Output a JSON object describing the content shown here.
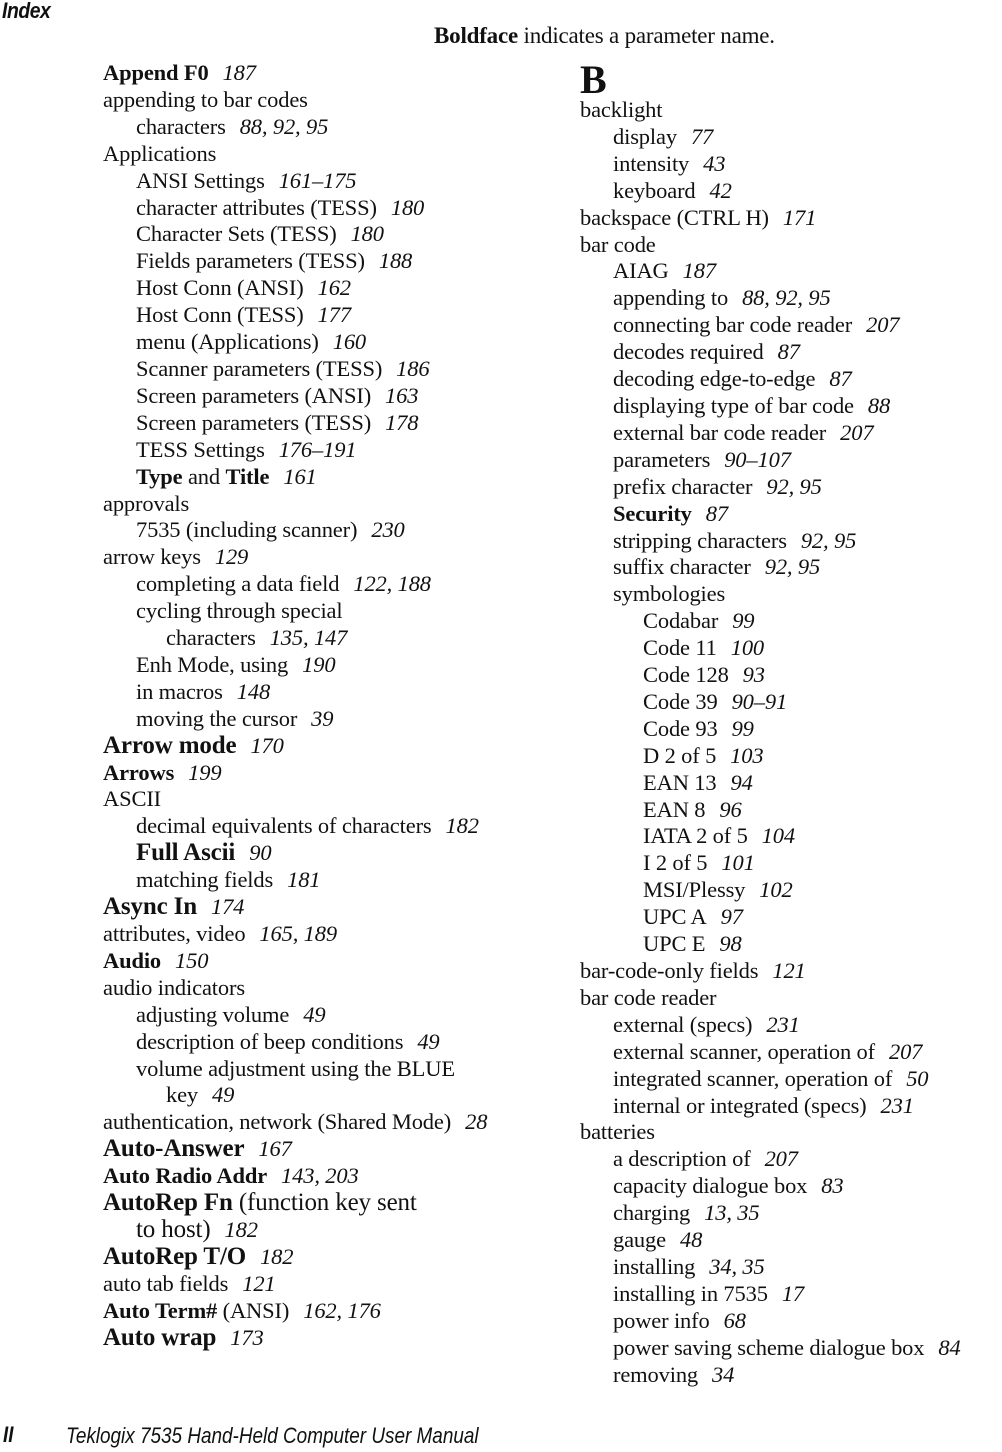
{
  "header": {
    "title": "Index"
  },
  "legend": {
    "bold_word": "Boldface",
    "rest": " indicates a parameter name."
  },
  "columns": [
    {
      "entries": [
        {
          "level": 1,
          "parts": [
            {
              "t": "Append F0",
              "b": true
            }
          ],
          "pages": "187"
        },
        {
          "level": 1,
          "parts": [
            {
              "t": "appending to bar codes"
            }
          ],
          "pages": ""
        },
        {
          "level": 2,
          "parts": [
            {
              "t": "characters"
            }
          ],
          "pages": "88, 92, 95"
        },
        {
          "level": 1,
          "parts": [
            {
              "t": "Applications"
            }
          ],
          "pages": ""
        },
        {
          "level": 2,
          "parts": [
            {
              "t": "ANSI Settings"
            }
          ],
          "pages": "161–175"
        },
        {
          "level": 2,
          "parts": [
            {
              "t": "character attributes (TESS)"
            }
          ],
          "pages": "180"
        },
        {
          "level": 2,
          "parts": [
            {
              "t": "Character Sets (TESS)"
            }
          ],
          "pages": "180"
        },
        {
          "level": 2,
          "parts": [
            {
              "t": "Fields parameters (TESS)"
            }
          ],
          "pages": "188"
        },
        {
          "level": 2,
          "parts": [
            {
              "t": "Host Conn (ANSI)"
            }
          ],
          "pages": "162"
        },
        {
          "level": 2,
          "parts": [
            {
              "t": "Host Conn (TESS)"
            }
          ],
          "pages": "177"
        },
        {
          "level": 2,
          "parts": [
            {
              "t": "menu (Applications)"
            }
          ],
          "pages": "160"
        },
        {
          "level": 2,
          "parts": [
            {
              "t": "Scanner parameters (TESS)"
            }
          ],
          "pages": "186"
        },
        {
          "level": 2,
          "parts": [
            {
              "t": "Screen parameters (ANSI)"
            }
          ],
          "pages": "163"
        },
        {
          "level": 2,
          "parts": [
            {
              "t": "Screen parameters (TESS)"
            }
          ],
          "pages": "178"
        },
        {
          "level": 2,
          "parts": [
            {
              "t": "TESS Settings"
            }
          ],
          "pages": "176–191"
        },
        {
          "level": 2,
          "parts": [
            {
              "t": "Type",
              "b": true
            },
            {
              "t": " and "
            },
            {
              "t": "Title",
              "b": true
            }
          ],
          "pages": "161"
        },
        {
          "level": 1,
          "parts": [
            {
              "t": "approvals"
            }
          ],
          "pages": ""
        },
        {
          "level": 2,
          "parts": [
            {
              "t": "7535 (including scanner)"
            }
          ],
          "pages": "230"
        },
        {
          "level": 1,
          "parts": [
            {
              "t": "arrow keys"
            }
          ],
          "pages": "129"
        },
        {
          "level": 2,
          "parts": [
            {
              "t": "completing a data field"
            }
          ],
          "pages": "122, 188"
        },
        {
          "level": 2,
          "parts": [
            {
              "t": "cycling through special"
            }
          ],
          "pages": ""
        },
        {
          "level": 3,
          "parts": [
            {
              "t": "characters"
            }
          ],
          "pages": "135, 147"
        },
        {
          "level": 2,
          "parts": [
            {
              "t": "Enh Mode, using"
            }
          ],
          "pages": "190"
        },
        {
          "level": 2,
          "parts": [
            {
              "t": "in macros"
            }
          ],
          "pages": "148"
        },
        {
          "level": 2,
          "parts": [
            {
              "t": "moving the cursor"
            }
          ],
          "pages": "39"
        },
        {
          "level": 1,
          "parts": [
            {
              "t": "Arrow mode",
              "b": true,
              "big": true
            }
          ],
          "pages": "170"
        },
        {
          "level": 1,
          "parts": [
            {
              "t": "Arrows",
              "b": true
            }
          ],
          "pages": "199"
        },
        {
          "level": 1,
          "parts": [
            {
              "t": "ASCII"
            }
          ],
          "pages": ""
        },
        {
          "level": 2,
          "parts": [
            {
              "t": "decimal equivalents of characters"
            }
          ],
          "pages": "182"
        },
        {
          "level": 2,
          "parts": [
            {
              "t": "Full Ascii",
              "b": true,
              "big": true
            }
          ],
          "pages": "90"
        },
        {
          "level": 2,
          "parts": [
            {
              "t": "matching fields"
            }
          ],
          "pages": "181"
        },
        {
          "level": 1,
          "parts": [
            {
              "t": "Async In",
              "b": true,
              "big": true
            }
          ],
          "pages": "174"
        },
        {
          "level": 1,
          "parts": [
            {
              "t": "attributes, video"
            }
          ],
          "pages": "165, 189"
        },
        {
          "level": 1,
          "parts": [
            {
              "t": "Audio",
              "b": true
            }
          ],
          "pages": "150"
        },
        {
          "level": 1,
          "parts": [
            {
              "t": "audio indicators"
            }
          ],
          "pages": ""
        },
        {
          "level": 2,
          "parts": [
            {
              "t": "adjusting volume"
            }
          ],
          "pages": "49"
        },
        {
          "level": 2,
          "parts": [
            {
              "t": "description of beep conditions"
            }
          ],
          "pages": "49"
        },
        {
          "level": 2,
          "parts": [
            {
              "t": "volume adjustment using the BLUE"
            }
          ],
          "pages": ""
        },
        {
          "level": 3,
          "parts": [
            {
              "t": "key"
            }
          ],
          "pages": "49"
        },
        {
          "level": 1,
          "parts": [
            {
              "t": "authentication, network (Shared Mode)"
            }
          ],
          "pages": "28"
        },
        {
          "level": 1,
          "parts": [
            {
              "t": "Auto-Answer",
              "b": true,
              "big": true
            }
          ],
          "pages": "167"
        },
        {
          "level": 1,
          "parts": [
            {
              "t": "Auto Radio Addr",
              "b": true
            }
          ],
          "pages": "143, 203"
        },
        {
          "level": 1,
          "parts": [
            {
              "t": "AutoRep Fn",
              "b": true,
              "big": true
            },
            {
              "t": " (function key sent",
              "big": true
            }
          ],
          "pages": ""
        },
        {
          "level": 2,
          "parts": [
            {
              "t": "to host)",
              "big": true
            }
          ],
          "pages": "182"
        },
        {
          "level": 1,
          "parts": [
            {
              "t": "AutoRep T/O",
              "b": true,
              "big": true
            }
          ],
          "pages": "182"
        },
        {
          "level": 1,
          "parts": [
            {
              "t": "auto tab fields"
            }
          ],
          "pages": "121"
        },
        {
          "level": 1,
          "parts": [
            {
              "t": "Auto Term#",
              "b": true
            },
            {
              "t": " (ANSI)"
            }
          ],
          "pages": "162, 176"
        },
        {
          "level": 1,
          "parts": [
            {
              "t": "Auto wrap",
              "b": true,
              "big": true
            }
          ],
          "pages": "173"
        }
      ]
    },
    {
      "letter": "B",
      "entries": [
        {
          "level": 1,
          "parts": [
            {
              "t": "backlight"
            }
          ],
          "pages": ""
        },
        {
          "level": 2,
          "parts": [
            {
              "t": "display"
            }
          ],
          "pages": "77"
        },
        {
          "level": 2,
          "parts": [
            {
              "t": "intensity"
            }
          ],
          "pages": "43"
        },
        {
          "level": 2,
          "parts": [
            {
              "t": "keyboard"
            }
          ],
          "pages": "42"
        },
        {
          "level": 1,
          "parts": [
            {
              "t": "backspace (CTRL H)"
            }
          ],
          "pages": "171"
        },
        {
          "level": 1,
          "parts": [
            {
              "t": "bar code"
            }
          ],
          "pages": ""
        },
        {
          "level": 2,
          "parts": [
            {
              "t": "AIAG"
            }
          ],
          "pages": "187"
        },
        {
          "level": 2,
          "parts": [
            {
              "t": "appending to"
            }
          ],
          "pages": "88, 92, 95"
        },
        {
          "level": 2,
          "parts": [
            {
              "t": "connecting bar code reader"
            }
          ],
          "pages": "207"
        },
        {
          "level": 2,
          "parts": [
            {
              "t": "decodes required"
            }
          ],
          "pages": "87"
        },
        {
          "level": 2,
          "parts": [
            {
              "t": "decoding edge-to-edge"
            }
          ],
          "pages": "87"
        },
        {
          "level": 2,
          "parts": [
            {
              "t": "displaying type of bar code"
            }
          ],
          "pages": "88"
        },
        {
          "level": 2,
          "parts": [
            {
              "t": "external bar code reader"
            }
          ],
          "pages": "207"
        },
        {
          "level": 2,
          "parts": [
            {
              "t": "parameters"
            }
          ],
          "pages": "90–107"
        },
        {
          "level": 2,
          "parts": [
            {
              "t": "prefix character"
            }
          ],
          "pages": "92, 95"
        },
        {
          "level": 2,
          "parts": [
            {
              "t": "Security",
              "b": true
            }
          ],
          "pages": "87"
        },
        {
          "level": 2,
          "parts": [
            {
              "t": "stripping characters"
            }
          ],
          "pages": "92, 95"
        },
        {
          "level": 2,
          "parts": [
            {
              "t": "suffix character"
            }
          ],
          "pages": "92, 95"
        },
        {
          "level": 2,
          "parts": [
            {
              "t": "symbologies"
            }
          ],
          "pages": ""
        },
        {
          "level": 3,
          "parts": [
            {
              "t": "Codabar"
            }
          ],
          "pages": "99"
        },
        {
          "level": 3,
          "parts": [
            {
              "t": "Code 11"
            }
          ],
          "pages": "100"
        },
        {
          "level": 3,
          "parts": [
            {
              "t": "Code 128"
            }
          ],
          "pages": "93"
        },
        {
          "level": 3,
          "parts": [
            {
              "t": "Code 39"
            }
          ],
          "pages": "90–91"
        },
        {
          "level": 3,
          "parts": [
            {
              "t": "Code 93"
            }
          ],
          "pages": "99"
        },
        {
          "level": 3,
          "parts": [
            {
              "t": "D 2 of 5"
            }
          ],
          "pages": "103"
        },
        {
          "level": 3,
          "parts": [
            {
              "t": "EAN 13"
            }
          ],
          "pages": "94"
        },
        {
          "level": 3,
          "parts": [
            {
              "t": "EAN 8"
            }
          ],
          "pages": "96"
        },
        {
          "level": 3,
          "parts": [
            {
              "t": "IATA 2 of 5"
            }
          ],
          "pages": "104"
        },
        {
          "level": 3,
          "parts": [
            {
              "t": "I 2 of 5"
            }
          ],
          "pages": "101"
        },
        {
          "level": 3,
          "parts": [
            {
              "t": "MSI/Plessy"
            }
          ],
          "pages": "102"
        },
        {
          "level": 3,
          "parts": [
            {
              "t": "UPC A"
            }
          ],
          "pages": "97"
        },
        {
          "level": 3,
          "parts": [
            {
              "t": "UPC E"
            }
          ],
          "pages": "98"
        },
        {
          "level": 1,
          "parts": [
            {
              "t": "bar-code-only fields"
            }
          ],
          "pages": "121"
        },
        {
          "level": 1,
          "parts": [
            {
              "t": "bar code reader"
            }
          ],
          "pages": ""
        },
        {
          "level": 2,
          "parts": [
            {
              "t": "external (specs)"
            }
          ],
          "pages": "231"
        },
        {
          "level": 2,
          "parts": [
            {
              "t": "external scanner, operation of"
            }
          ],
          "pages": "207"
        },
        {
          "level": 2,
          "parts": [
            {
              "t": "integrated scanner, operation of"
            }
          ],
          "pages": "50"
        },
        {
          "level": 2,
          "parts": [
            {
              "t": "internal or integrated (specs)"
            }
          ],
          "pages": "231"
        },
        {
          "level": 1,
          "parts": [
            {
              "t": "batteries"
            }
          ],
          "pages": ""
        },
        {
          "level": 2,
          "parts": [
            {
              "t": "a description of"
            }
          ],
          "pages": "207"
        },
        {
          "level": 2,
          "parts": [
            {
              "t": "capacity dialogue box"
            }
          ],
          "pages": "83"
        },
        {
          "level": 2,
          "parts": [
            {
              "t": "charging"
            }
          ],
          "pages": "13, 35"
        },
        {
          "level": 2,
          "parts": [
            {
              "t": "gauge"
            }
          ],
          "pages": "48"
        },
        {
          "level": 2,
          "parts": [
            {
              "t": "installing"
            }
          ],
          "pages": "34, 35"
        },
        {
          "level": 2,
          "parts": [
            {
              "t": "installing in 7535"
            }
          ],
          "pages": "17"
        },
        {
          "level": 2,
          "parts": [
            {
              "t": "power info"
            }
          ],
          "pages": "68"
        },
        {
          "level": 2,
          "parts": [
            {
              "t": "power saving scheme dialogue box"
            }
          ],
          "pages": "84"
        },
        {
          "level": 2,
          "parts": [
            {
              "t": "removing"
            }
          ],
          "pages": "34"
        }
      ]
    }
  ],
  "footer": {
    "page_number": "II",
    "manual_title": "Teklogix 7535 Hand-Held Computer User Manual"
  }
}
